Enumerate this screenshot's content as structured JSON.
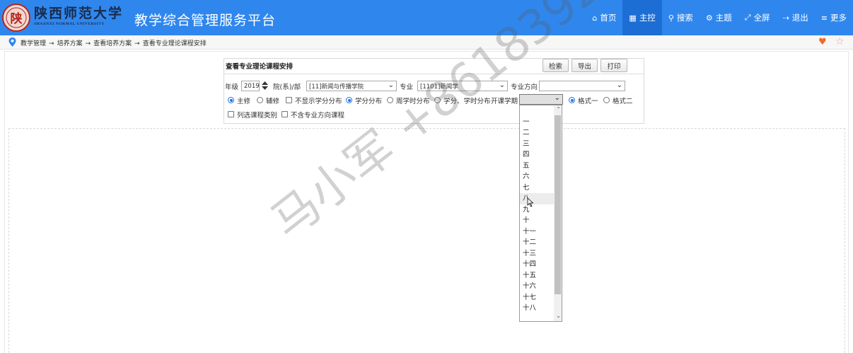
{
  "header": {
    "school_name_cn": "陕西师范大学",
    "school_name_en": "SHAANXI NORMAL UNIVERSITY",
    "seal_text": "陕",
    "platform_title": "教学综合管理服务平台",
    "nav": [
      {
        "label": "首页",
        "icon": "home-icon"
      },
      {
        "label": "主控",
        "icon": "windows-icon",
        "active": true
      },
      {
        "label": "搜索",
        "icon": "search-icon"
      },
      {
        "label": "主题",
        "icon": "gears-icon"
      },
      {
        "label": "全屏",
        "icon": "expand-icon"
      },
      {
        "label": "退出",
        "icon": "logout-icon"
      },
      {
        "label": "更多",
        "icon": "menu-icon"
      }
    ],
    "colors": {
      "bar": "#2f87ee",
      "active": "#1c6ed4"
    }
  },
  "breadcrumb": {
    "items": [
      "教学管理",
      "培养方案",
      "查看培养方案",
      "查看专业理论课程安排"
    ],
    "separator": "→"
  },
  "panel": {
    "title": "查看专业理论课程安排",
    "buttons": {
      "search": "检索",
      "export": "导出",
      "print": "打印"
    },
    "grade_label": "年级",
    "grade_value": "2019",
    "college_label": "院(系)/部",
    "college_value": "[11]新闻与传播学院",
    "major_label": "专业",
    "major_value": "[1101]新闻学",
    "direction_label": "专业方向",
    "direction_value": "",
    "radio_major": "主修",
    "radio_minor": "辅修",
    "check_no_credit": "不显示学分分布",
    "radio_credit": "学分分布",
    "radio_weekly": "周学时分布",
    "radio_credit_hours": "学分、学时分布",
    "term_label": "开课学期",
    "radio_format1": "格式一",
    "radio_format2": "格式二",
    "check_list_type": "列选课程类别",
    "check_no_direction": "不含专业方向课程"
  },
  "term_options": [
    "",
    "一",
    "二",
    "三",
    "四",
    "五",
    "六",
    "七",
    "八",
    "九",
    "十",
    "十一",
    "十二",
    "十三",
    "十四",
    "十五",
    "十六",
    "十七",
    "十八"
  ],
  "term_highlighted": "八",
  "watermark": "马小军 +8618392970"
}
